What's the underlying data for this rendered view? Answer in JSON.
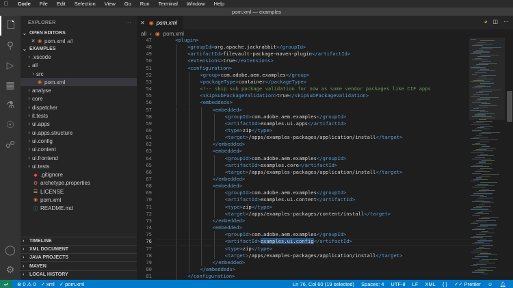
{
  "menubar": {
    "apple_icon": "apple-icon",
    "items": [
      "Code",
      "File",
      "Edit",
      "Selection",
      "View",
      "Go",
      "Run",
      "Terminal",
      "Window",
      "Help"
    ],
    "window_title": "pom.xml — examples"
  },
  "activity_bar": {
    "items": [
      "files-icon",
      "search-icon",
      "run-debug-icon",
      "extensions-icon",
      "test-icon",
      "git-lens-icon",
      "source-control-icon"
    ],
    "bottom": [
      "account-icon",
      "settings-icon"
    ]
  },
  "sidebar": {
    "title": "EXPLORER",
    "open_editors_label": "OPEN EDITORS",
    "open_editor": {
      "name": "pom.xml",
      "folder": "all"
    },
    "workspace_label": "EXAMPLES",
    "tree": [
      {
        "label": ".vscode",
        "chevron": "›",
        "icon": "",
        "indent": 1
      },
      {
        "label": "all",
        "chevron": "⌄",
        "icon": "",
        "indent": 1
      },
      {
        "label": "src",
        "chevron": "›",
        "icon": "",
        "indent": 2
      },
      {
        "label": "pom.xml",
        "chevron": "",
        "icon": "rss",
        "indent": 2
      },
      {
        "label": "analyse",
        "chevron": "›",
        "icon": "",
        "indent": 1
      },
      {
        "label": "core",
        "chevron": "›",
        "icon": "",
        "indent": 1
      },
      {
        "label": "dispatcher",
        "chevron": "›",
        "icon": "",
        "indent": 1
      },
      {
        "label": "it.tests",
        "chevron": "›",
        "icon": "",
        "indent": 1
      },
      {
        "label": "ui.apps",
        "chevron": "›",
        "icon": "",
        "indent": 1
      },
      {
        "label": "ui.apps.structure",
        "chevron": "›",
        "icon": "",
        "indent": 1
      },
      {
        "label": "ui.config",
        "chevron": "›",
        "icon": "",
        "indent": 1
      },
      {
        "label": "ui.content",
        "chevron": "›",
        "icon": "",
        "indent": 1
      },
      {
        "label": "ui.frontend",
        "chevron": "›",
        "icon": "",
        "indent": 1
      },
      {
        "label": "ui.tests",
        "chevron": "›",
        "icon": "",
        "indent": 1
      },
      {
        "label": ".gitignore",
        "chevron": "",
        "icon": "diamond",
        "indent": 1
      },
      {
        "label": "archetype.properties",
        "chevron": "",
        "icon": "gear",
        "indent": 1
      },
      {
        "label": "LICENSE",
        "chevron": "",
        "icon": "license",
        "indent": 1
      },
      {
        "label": "pom.xml",
        "chevron": "",
        "icon": "rss",
        "indent": 1
      },
      {
        "label": "README.md",
        "chevron": "",
        "icon": "info",
        "indent": 1
      }
    ],
    "bottom_sections": [
      "TIMELINE",
      "XML DOCUMENT",
      "JAVA PROJECTS",
      "MAVEN",
      "LOCAL HISTORY"
    ]
  },
  "editor": {
    "tab_label": "pom.xml",
    "breadcrumb": [
      "all",
      "pom.xml"
    ],
    "current_line": 76,
    "lines": [
      {
        "n": 47,
        "indent": 3,
        "parts": [
          [
            "t",
            "<plugin>"
          ]
        ]
      },
      {
        "n": 48,
        "indent": 4,
        "parts": [
          [
            "t",
            "<groupId>"
          ],
          [
            "tx",
            "org.apache.jackrabbit"
          ],
          [
            "t",
            "</groupId>"
          ]
        ]
      },
      {
        "n": 49,
        "indent": 4,
        "parts": [
          [
            "t",
            "<artifactId>"
          ],
          [
            "tx",
            "filevault-package-maven-plugin"
          ],
          [
            "t",
            "</artifactId>"
          ]
        ]
      },
      {
        "n": 50,
        "indent": 4,
        "parts": [
          [
            "t",
            "<extensions>"
          ],
          [
            "tx",
            "true"
          ],
          [
            "t",
            "</extensions>"
          ]
        ]
      },
      {
        "n": 51,
        "indent": 4,
        "parts": [
          [
            "t",
            "<configuration>"
          ]
        ]
      },
      {
        "n": 52,
        "indent": 5,
        "parts": [
          [
            "t",
            "<group>"
          ],
          [
            "tx",
            "com.adobe.aem.examples"
          ],
          [
            "t",
            "</group>"
          ]
        ]
      },
      {
        "n": 53,
        "indent": 5,
        "parts": [
          [
            "t",
            "<packageType>"
          ],
          [
            "tx",
            "container"
          ],
          [
            "t",
            "</packageType>"
          ]
        ]
      },
      {
        "n": 54,
        "indent": 5,
        "parts": [
          [
            "cm",
            "<!-- skip sub package validation for now as some vendor packages like CIF apps"
          ]
        ]
      },
      {
        "n": 55,
        "indent": 5,
        "parts": [
          [
            "t",
            "<skipSubPackageValidation>"
          ],
          [
            "tx",
            "true"
          ],
          [
            "t",
            "</skipSubPackageValidation>"
          ]
        ]
      },
      {
        "n": 56,
        "indent": 5,
        "parts": [
          [
            "t",
            "<embeddeds>"
          ]
        ]
      },
      {
        "n": 57,
        "indent": 6,
        "parts": [
          [
            "t",
            "<embedded>"
          ]
        ]
      },
      {
        "n": 58,
        "indent": 7,
        "parts": [
          [
            "t",
            "<groupId>"
          ],
          [
            "tx",
            "com.adobe.aem.examples"
          ],
          [
            "t",
            "</groupId>"
          ]
        ]
      },
      {
        "n": 59,
        "indent": 7,
        "parts": [
          [
            "t",
            "<artifactId>"
          ],
          [
            "tx",
            "examples.ui.apps"
          ],
          [
            "t",
            "</artifactId>"
          ]
        ]
      },
      {
        "n": 60,
        "indent": 7,
        "parts": [
          [
            "t",
            "<type>"
          ],
          [
            "tx",
            "zip"
          ],
          [
            "t",
            "</type>"
          ]
        ]
      },
      {
        "n": 61,
        "indent": 7,
        "parts": [
          [
            "t",
            "<target>"
          ],
          [
            "tx",
            "/apps/examples-packages/application/install"
          ],
          [
            "t",
            "</target>"
          ]
        ]
      },
      {
        "n": 62,
        "indent": 6,
        "parts": [
          [
            "t",
            "</embedded>"
          ]
        ]
      },
      {
        "n": 63,
        "indent": 6,
        "parts": [
          [
            "t",
            "<embedded>"
          ]
        ]
      },
      {
        "n": 64,
        "indent": 7,
        "parts": [
          [
            "t",
            "<groupId>"
          ],
          [
            "tx",
            "com.adobe.aem.examples"
          ],
          [
            "t",
            "</groupId>"
          ]
        ]
      },
      {
        "n": 65,
        "indent": 7,
        "parts": [
          [
            "t",
            "<artifactId>"
          ],
          [
            "tx",
            "examples.core"
          ],
          [
            "t",
            "</artifactId>"
          ]
        ]
      },
      {
        "n": 66,
        "indent": 7,
        "parts": [
          [
            "t",
            "<target>"
          ],
          [
            "tx",
            "/apps/examples-packages/application/install"
          ],
          [
            "t",
            "</target>"
          ]
        ]
      },
      {
        "n": 67,
        "indent": 6,
        "parts": [
          [
            "t",
            "</embedded>"
          ]
        ]
      },
      {
        "n": 68,
        "indent": 6,
        "parts": [
          [
            "t",
            "<embedded>"
          ]
        ]
      },
      {
        "n": 69,
        "indent": 7,
        "parts": [
          [
            "t",
            "<groupId>"
          ],
          [
            "tx",
            "com.adobe.aem.examples"
          ],
          [
            "t",
            "</groupId>"
          ]
        ]
      },
      {
        "n": 70,
        "indent": 7,
        "parts": [
          [
            "t",
            "<artifactId>"
          ],
          [
            "tx",
            "examples.ui.content"
          ],
          [
            "t",
            "</artifactId>"
          ]
        ]
      },
      {
        "n": 71,
        "indent": 7,
        "parts": [
          [
            "t",
            "<type>"
          ],
          [
            "tx",
            "zip"
          ],
          [
            "t",
            "</type>"
          ]
        ]
      },
      {
        "n": 72,
        "indent": 7,
        "parts": [
          [
            "t",
            "<target>"
          ],
          [
            "tx",
            "/apps/examples-packages/content/install"
          ],
          [
            "t",
            "</target>"
          ]
        ]
      },
      {
        "n": 73,
        "indent": 6,
        "parts": [
          [
            "t",
            "</embedded>"
          ]
        ]
      },
      {
        "n": 74,
        "indent": 6,
        "parts": [
          [
            "t",
            "<embedded>"
          ]
        ]
      },
      {
        "n": 75,
        "indent": 7,
        "parts": [
          [
            "t",
            "<groupId>"
          ],
          [
            "tx",
            "com.adobe.aem.examples"
          ],
          [
            "t",
            "</groupId>"
          ]
        ]
      },
      {
        "n": 76,
        "indent": 7,
        "parts": [
          [
            "t",
            "<artifactId>"
          ],
          [
            "sel",
            "examples.ui.config"
          ],
          [
            "t",
            "</artifactId>"
          ]
        ]
      },
      {
        "n": 77,
        "indent": 7,
        "parts": [
          [
            "t",
            "<type>"
          ],
          [
            "tx",
            "zip"
          ],
          [
            "t",
            "</type>"
          ]
        ]
      },
      {
        "n": 78,
        "indent": 7,
        "parts": [
          [
            "t",
            "<target>"
          ],
          [
            "tx",
            "/apps/examples-packages/application/install"
          ],
          [
            "t",
            "</target>"
          ]
        ]
      },
      {
        "n": 79,
        "indent": 6,
        "parts": [
          [
            "t",
            "</embedded>"
          ]
        ]
      },
      {
        "n": 80,
        "indent": 5,
        "parts": [
          [
            "t",
            "</embeddeds>"
          ]
        ]
      },
      {
        "n": 81,
        "indent": 4,
        "parts": [
          [
            "t",
            "</configuration>"
          ]
        ]
      }
    ]
  },
  "statusbar": {
    "errors": "0",
    "warnings": "0",
    "xml_item": "xml",
    "pom_item": "pom.xml",
    "position": "Ln 76, Col 60 (19 selected)",
    "spaces": "Spaces: 4",
    "encoding": "UTF-8",
    "eol": "LF",
    "language": "XML",
    "prettier": "Prettier",
    "colors": {
      "bg": "#007acc",
      "remote": "#16825d"
    }
  }
}
